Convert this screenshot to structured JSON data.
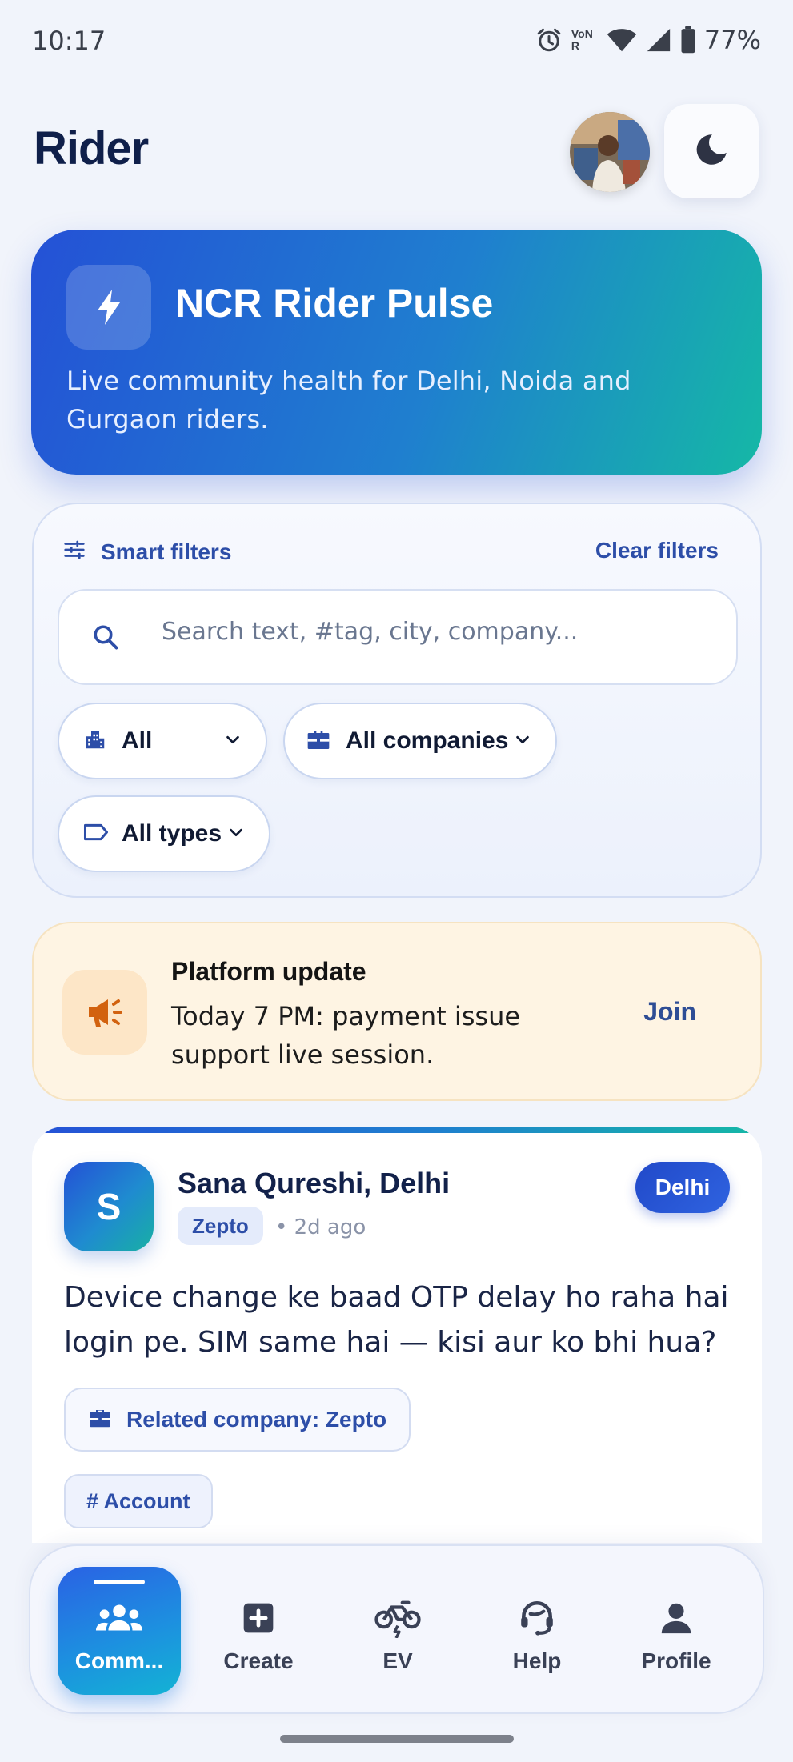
{
  "status_bar": {
    "time": "10:17",
    "network_label": "VoNR",
    "battery": "77%"
  },
  "header": {
    "title": "Rider"
  },
  "hero": {
    "title": "NCR Rider Pulse",
    "subtitle": "Live community health for Delhi, Noida and Gurgaon riders."
  },
  "filters": {
    "title": "Smart filters",
    "clear_label": "Clear filters",
    "search_placeholder": "Search text, #tag, city, company...",
    "city_value": "All",
    "company_value": "All companies",
    "type_value": "All types"
  },
  "update": {
    "title": "Platform update",
    "text": "Today 7 PM: payment issue support live session.",
    "join_label": "Join"
  },
  "post": {
    "avatar_initial": "S",
    "author": "Sana Qureshi, Delhi",
    "company": "Zepto",
    "time": "• 2d ago",
    "city": "Delhi",
    "text": "Device change ke baad OTP delay ho raha hai login pe. SIM same hai — kisi aur ko bhi hua?",
    "related_company": "Related company: Zepto",
    "tag": "# Account"
  },
  "nav": {
    "items": [
      {
        "label": "Comm...",
        "icon": "community-icon",
        "active": true
      },
      {
        "label": "Create",
        "icon": "add-box-icon",
        "active": false
      },
      {
        "label": "EV",
        "icon": "ev-bike-icon",
        "active": false
      },
      {
        "label": "Help",
        "icon": "support-agent-icon",
        "active": false
      },
      {
        "label": "Profile",
        "icon": "person-icon",
        "active": false
      }
    ]
  },
  "colors": {
    "brand_blue": "#2451d6",
    "brand_teal": "#15b8a6",
    "link_blue": "#2d4ea8",
    "update_bg": "#fef4e3",
    "update_icon": "#d2620f"
  }
}
